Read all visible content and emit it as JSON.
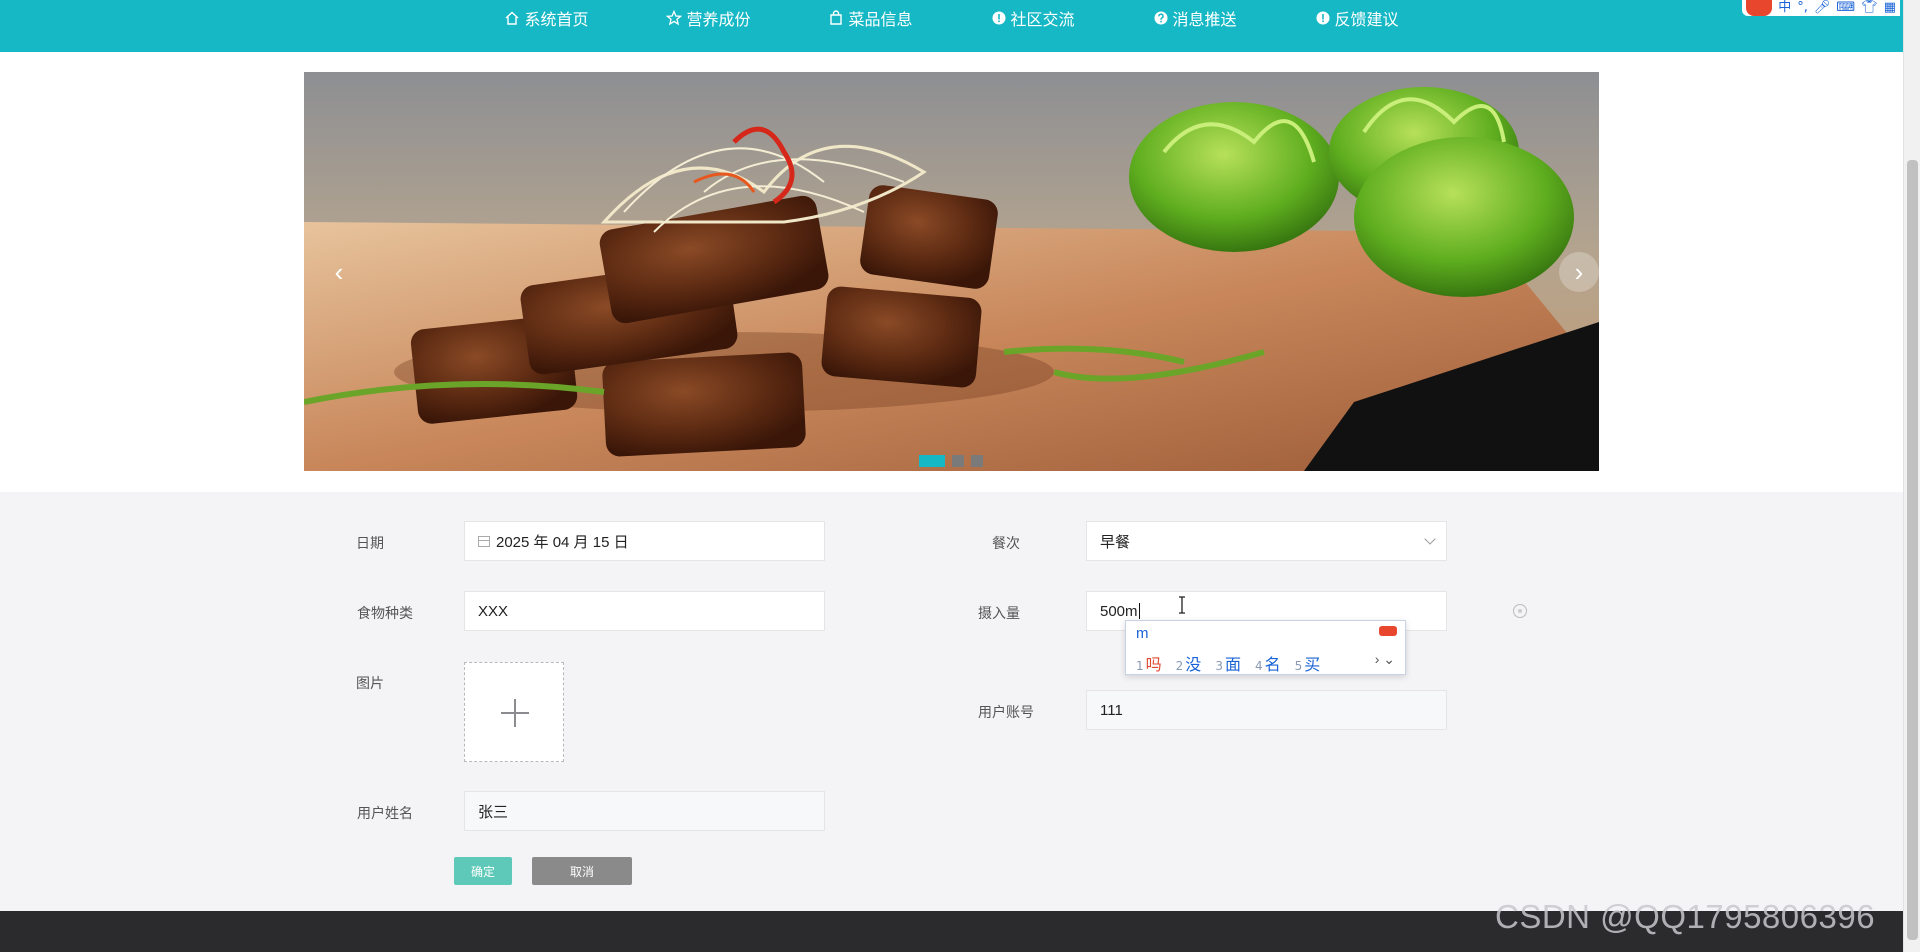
{
  "nav": {
    "items": [
      {
        "label": "系统首页",
        "icon": "home-icon"
      },
      {
        "label": "营养成份",
        "icon": "star-icon"
      },
      {
        "label": "菜品信息",
        "icon": "bag-icon"
      },
      {
        "label": "社区交流",
        "icon": "info-icon"
      },
      {
        "label": "消息推送",
        "icon": "question-icon"
      },
      {
        "label": "反馈建议",
        "icon": "info-icon"
      }
    ]
  },
  "ime_toolbar": {
    "lang": "中"
  },
  "carousel": {
    "slide_count": 3,
    "active_slide": 1
  },
  "form": {
    "date_label": "日期",
    "date_value": "2025 年 04 月 15 日",
    "meal_label": "餐次",
    "meal_value": "早餐",
    "food_type_label": "食物种类",
    "food_type_value": "XXX",
    "intake_label": "摄入量",
    "intake_value": "500m",
    "image_label": "图片",
    "account_label": "用户账号",
    "account_value": "111",
    "name_label": "用户姓名",
    "name_value": "张三",
    "confirm_label": "确定",
    "cancel_label": "取消"
  },
  "ime_popup": {
    "composition": "m",
    "candidates": [
      {
        "num": "1",
        "text": "吗"
      },
      {
        "num": "2",
        "text": "没"
      },
      {
        "num": "3",
        "text": "面"
      },
      {
        "num": "4",
        "text": "名"
      },
      {
        "num": "5",
        "text": "买"
      }
    ],
    "more": "› ⌄"
  },
  "watermark": "CSDN @QQ1795806396",
  "colors": {
    "accent": "#17b8c5",
    "confirm": "#5ec9b8",
    "cancel": "#8a8a8a",
    "footer": "#2b2b2d"
  }
}
